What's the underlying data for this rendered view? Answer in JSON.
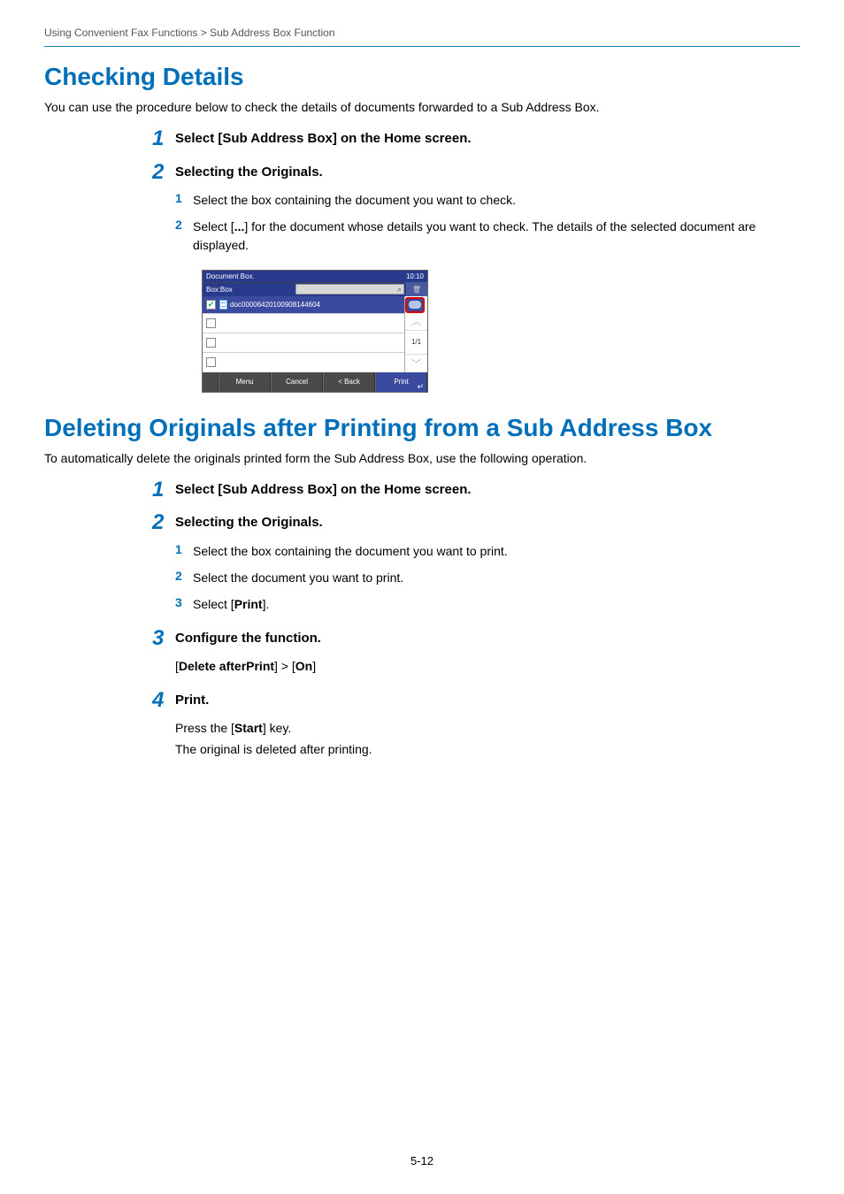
{
  "breadcrumb": "Using Convenient Fax Functions > Sub Address Box Function",
  "section1": {
    "heading": "Checking Details",
    "intro": "You can use the procedure below to check the details of documents forwarded to a Sub Address Box.",
    "step1": {
      "num": "1",
      "title": "Select [Sub Address Box] on the Home screen."
    },
    "step2": {
      "num": "2",
      "title": "Selecting the Originals.",
      "sub1": {
        "num": "1",
        "text": "Select the box containing the document you want to check."
      },
      "sub2": {
        "num": "2",
        "pre": "Select [",
        "bold": "...",
        "post": "] for the document whose details you want to check. The details of the selected document are displayed."
      }
    }
  },
  "screenshot": {
    "title": "Document Box.",
    "time": "10:10",
    "box_label": "Box:Box",
    "doc_name": "doc00006420100908144604",
    "paging": "1/1",
    "menu": "Menu",
    "cancel": "Cancel",
    "back": "< Back",
    "print": "Print"
  },
  "section2": {
    "heading": "Deleting Originals after Printing from a Sub Address Box",
    "intro": "To automatically delete the originals printed form the Sub Address Box, use the following operation.",
    "step1": {
      "num": "1",
      "title": "Select [Sub Address Box] on the Home screen."
    },
    "step2": {
      "num": "2",
      "title": "Selecting the Originals.",
      "sub1": {
        "num": "1",
        "text": "Select the box containing the document you want to print."
      },
      "sub2": {
        "num": "2",
        "text": "Select the document you want to print."
      },
      "sub3": {
        "num": "3",
        "pre": "Select [",
        "bold": "Print",
        "post": "]."
      }
    },
    "step3": {
      "num": "3",
      "title": "Configure the function.",
      "body_pre": "[",
      "body_bold1": "Delete afterPrint",
      "body_mid": "] > [",
      "body_bold2": "On",
      "body_post": "]"
    },
    "step4": {
      "num": "4",
      "title": "Print.",
      "line1_pre": "Press the [",
      "line1_bold": "Start",
      "line1_post": "] key.",
      "line2": "The original is deleted after printing."
    }
  },
  "page_number": "5-12"
}
